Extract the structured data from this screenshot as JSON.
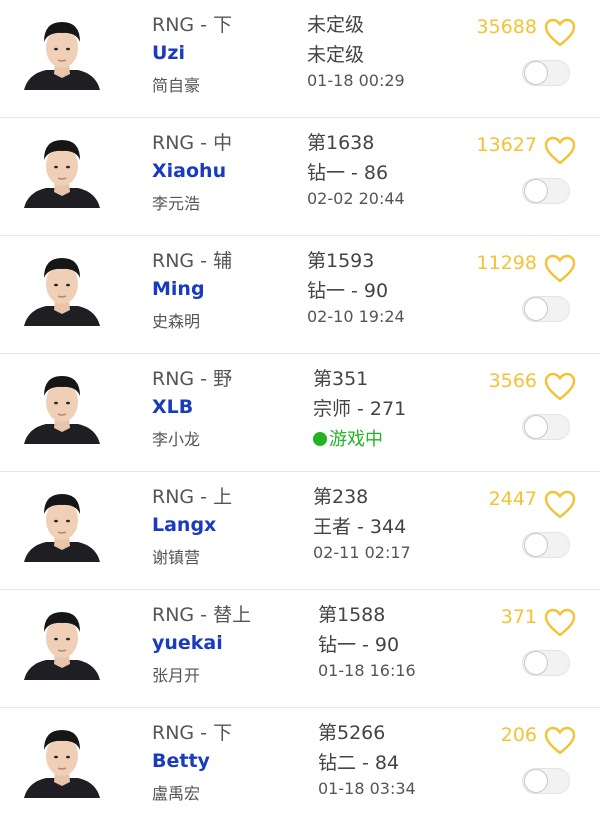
{
  "players": [
    {
      "team_role": "RNG - 下",
      "name": "Uzi",
      "real_name": "简自豪",
      "rank": "未定级",
      "tier": "未定级",
      "last_seen": "01-18 00:29",
      "likes": "35688",
      "in_game": false
    },
    {
      "team_role": "RNG - 中",
      "name": "Xiaohu",
      "real_name": "李元浩",
      "rank": "第1638",
      "tier": "钻一 - 86",
      "last_seen": "02-02 20:44",
      "likes": "13627",
      "in_game": false
    },
    {
      "team_role": "RNG - 辅",
      "name": "Ming",
      "real_name": "史森明",
      "rank": "第1593",
      "tier": "钻一 - 90",
      "last_seen": "02-10 19:24",
      "likes": "11298",
      "in_game": false
    },
    {
      "team_role": "RNG - 野",
      "name": "XLB",
      "real_name": "李小龙",
      "rank": "第351",
      "tier": "宗师 - 271",
      "last_seen": "游戏中",
      "likes": "3566",
      "in_game": true
    },
    {
      "team_role": "RNG - 上",
      "name": "Langx",
      "real_name": "谢镇营",
      "rank": "第238",
      "tier": "王者 - 344",
      "last_seen": "02-11 02:17",
      "likes": "2447",
      "in_game": false
    },
    {
      "team_role": "RNG - 替上",
      "name": "yuekai",
      "real_name": "张月开",
      "rank": "第1588",
      "tier": "钻一 - 90",
      "last_seen": "01-18 16:16",
      "likes": "371",
      "in_game": false
    },
    {
      "team_role": "RNG - 下",
      "name": "Betty",
      "real_name": "盧禹宏",
      "rank": "第5266",
      "tier": "钻二 - 84",
      "last_seen": "01-18 03:34",
      "likes": "206",
      "in_game": false
    }
  ],
  "colors": {
    "name": "#1a3bbd",
    "likes": "#f5c233",
    "in_game": "#22b422"
  },
  "icons": {
    "like": "heart-outline-icon",
    "follow": "toggle-switch"
  }
}
